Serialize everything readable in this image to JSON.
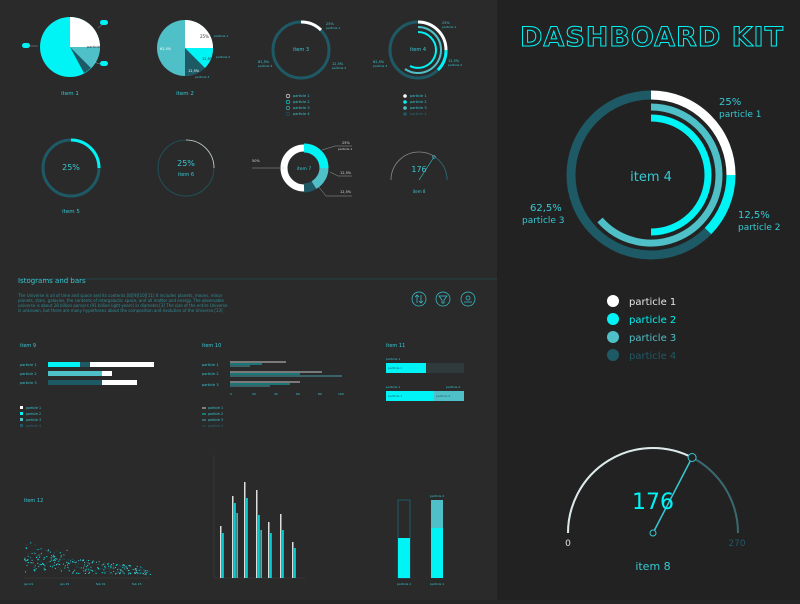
{
  "colors": {
    "cyan": "#00f3f5",
    "mid": "#4fc0c8",
    "dark": "#1e5a66",
    "white": "#ffffff"
  },
  "title": "DASHBOARD KIT",
  "big_donut": {
    "center": "item 4",
    "labels": [
      {
        "pct": "25%",
        "name": "particle 1"
      },
      {
        "pct": "12,5%",
        "name": "particle 2"
      },
      {
        "pct": "62,5%",
        "name": "particle 3"
      }
    ],
    "legend": [
      "particle 1",
      "particle 2",
      "particle 3",
      "particle 4"
    ]
  },
  "gauge": {
    "value": "176",
    "min": "0",
    "max": "270",
    "label": "item 8",
    "fraction": 0.652
  },
  "small": {
    "item1": "item 1",
    "item2": "item 2",
    "item3": "item 3",
    "item4": "item 4",
    "item5": "item 5",
    "item5_val": "25%",
    "item6": "item 6",
    "item6_val": "25%",
    "item7": "item 7",
    "item8": "item 8",
    "item8_val": "176",
    "pct25": "25%",
    "pct125": "12,5%",
    "pct625": "62,5%",
    "pct50": "50%",
    "particle": "particle 1",
    "legend3": [
      "particle 1",
      "particle 2",
      "particle 3",
      "particle 4"
    ],
    "legend4": [
      "particle 1",
      "particle 2",
      "particle 3",
      "particle 4"
    ]
  },
  "section": {
    "title": "Istograms and bars",
    "paragraph_1": "The Universe is all of time and space and its contents.[8][9][10][11] It includes planets, moons, minor",
    "paragraph_2": "planets, stars, galaxies, the contents of intergalactic space, and all matter and energy. The observable",
    "paragraph_3": "universe is about 28 billion parsecs (91 billion light-years) in diameter.[3] The size of the entire Universe",
    "paragraph_4": "is unknown, but there are many hypotheses about the composition and evolution of the Universe.[13]"
  },
  "bars": {
    "item9": "item 9",
    "item10": "item 10",
    "item11": "item 11",
    "item12": "item 12",
    "particles": [
      "particle 1",
      "particle 2",
      "particle 3",
      "particle 4"
    ],
    "axis10": [
      "0",
      "20",
      "40",
      "60",
      "80",
      "100"
    ],
    "axis12": [
      "jan 01",
      "jan 15",
      "feb 01",
      "feb 15"
    ]
  }
}
